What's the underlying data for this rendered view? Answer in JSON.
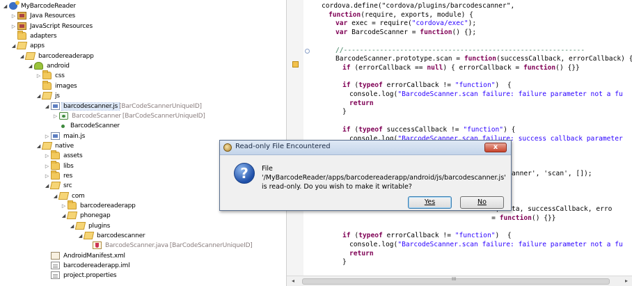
{
  "tree": {
    "items": [
      {
        "label": "MyBarcodeReader",
        "depth": 0,
        "expander": "open",
        "icon": "project-icon"
      },
      {
        "label": "Java Resources",
        "depth": 1,
        "expander": "closed",
        "icon": "library-icon"
      },
      {
        "label": "JavaScript Resources",
        "depth": 1,
        "expander": "closed",
        "icon": "library-icon"
      },
      {
        "label": "adapters",
        "depth": 1,
        "expander": "none",
        "icon": "folder-icon"
      },
      {
        "label": "apps",
        "depth": 1,
        "expander": "open",
        "icon": "open-folder-icon"
      },
      {
        "label": "barcodereaderapp",
        "depth": 2,
        "expander": "open",
        "icon": "open-folder-icon"
      },
      {
        "label": "android",
        "depth": 3,
        "expander": "open",
        "icon": "android-icon"
      },
      {
        "label": "css",
        "depth": 4,
        "expander": "closed",
        "icon": "folder-icon"
      },
      {
        "label": "images",
        "depth": 4,
        "expander": "none",
        "icon": "folder-icon"
      },
      {
        "label": "js",
        "depth": 4,
        "expander": "open",
        "icon": "open-folder-icon"
      },
      {
        "label": "barcodescanner.js",
        "suffix": "[BarCodeScannerUniqueID]",
        "depth": 5,
        "expander": "open",
        "icon": "js-file-icon",
        "selected": true
      },
      {
        "label": "BarcodeScanner",
        "suffix": "[BarCodeScannerUniqueID]",
        "depth": 6,
        "expander": "closed",
        "icon": "js-class-icon",
        "dim": true
      },
      {
        "label": "BarcodeScanner",
        "depth": 6,
        "expander": "none",
        "icon": "dot",
        "dot": true
      },
      {
        "label": "main.js",
        "depth": 5,
        "expander": "closed",
        "icon": "js-file-icon"
      },
      {
        "label": "native",
        "depth": 4,
        "expander": "open",
        "icon": "open-folder-icon"
      },
      {
        "label": "assets",
        "depth": 5,
        "expander": "closed",
        "icon": "folder-icon"
      },
      {
        "label": "libs",
        "depth": 5,
        "expander": "closed",
        "icon": "folder-icon"
      },
      {
        "label": "res",
        "depth": 5,
        "expander": "closed",
        "icon": "folder-icon"
      },
      {
        "label": "src",
        "depth": 5,
        "expander": "open",
        "icon": "open-folder-icon"
      },
      {
        "label": "com",
        "depth": 6,
        "expander": "open",
        "icon": "open-folder-icon"
      },
      {
        "label": "barcodereaderapp",
        "depth": 7,
        "expander": "closed",
        "icon": "folder-icon"
      },
      {
        "label": "phonegap",
        "depth": 7,
        "expander": "open",
        "icon": "open-folder-icon"
      },
      {
        "label": "plugins",
        "depth": 8,
        "expander": "open",
        "icon": "open-folder-icon"
      },
      {
        "label": "barcodescanner",
        "depth": 9,
        "expander": "open",
        "icon": "open-folder-icon"
      },
      {
        "label": "BarcodeScanner.java",
        "suffix": "[BarCodeScannerUniqueID]",
        "depth": 10,
        "expander": "none",
        "icon": "java-file-icon",
        "dim": true
      },
      {
        "label": "AndroidManifest.xml",
        "depth": 5,
        "expander": "none",
        "icon": "xml-file-icon"
      },
      {
        "label": "barcodereaderapp.iml",
        "depth": 5,
        "expander": "none",
        "icon": "document-icon"
      },
      {
        "label": "project.properties",
        "depth": 5,
        "expander": "none",
        "icon": "document-icon"
      }
    ]
  },
  "editor": {
    "lines": [
      {
        "indent": 1,
        "parts": [
          [
            "t",
            "cordova.define(\"cordova/plugins/barcodescanner\","
          ]
        ]
      },
      {
        "indent": 2,
        "parts": [
          [
            "k",
            "function"
          ],
          [
            "t",
            "(require, exports, module) {"
          ]
        ]
      },
      {
        "indent": 3,
        "parts": [
          [
            "k",
            "var"
          ],
          [
            "t",
            " exec = require("
          ],
          [
            "s",
            "\"cordova/exec\""
          ],
          [
            "t",
            ");"
          ]
        ]
      },
      {
        "indent": 3,
        "parts": [
          [
            "k",
            "var"
          ],
          [
            "t",
            " BarcodeScanner = "
          ],
          [
            "k",
            "function"
          ],
          [
            "t",
            "() {};"
          ]
        ]
      },
      {
        "indent": 0,
        "parts": []
      },
      {
        "indent": 3,
        "parts": [
          [
            "c",
            "//------------------------------------------------------------"
          ]
        ]
      },
      {
        "indent": 3,
        "parts": [
          [
            "t",
            "BarcodeScanner.prototype.scan = "
          ],
          [
            "k",
            "function"
          ],
          [
            "t",
            "(successCallback, errorCallback) {"
          ]
        ]
      },
      {
        "indent": 4,
        "parts": [
          [
            "k",
            "if"
          ],
          [
            "t",
            " (errorCallback == "
          ],
          [
            "k",
            "null"
          ],
          [
            "t",
            ") { errorCallback = "
          ],
          [
            "k",
            "function"
          ],
          [
            "t",
            "() {}}"
          ]
        ]
      },
      {
        "indent": 0,
        "parts": []
      },
      {
        "indent": 4,
        "parts": [
          [
            "k",
            "if"
          ],
          [
            "t",
            " ("
          ],
          [
            "k",
            "typeof"
          ],
          [
            "t",
            " errorCallback != "
          ],
          [
            "s",
            "\"function\""
          ],
          [
            "t",
            ")  {"
          ]
        ]
      },
      {
        "indent": 5,
        "parts": [
          [
            "t",
            "console.log("
          ],
          [
            "s",
            "\"BarcodeScanner.scan failure: failure parameter not a fu"
          ]
        ]
      },
      {
        "indent": 5,
        "parts": [
          [
            "k",
            "return"
          ]
        ]
      },
      {
        "indent": 4,
        "parts": [
          [
            "t",
            "}"
          ]
        ]
      },
      {
        "indent": 0,
        "parts": []
      },
      {
        "indent": 4,
        "parts": [
          [
            "k",
            "if"
          ],
          [
            "t",
            " ("
          ],
          [
            "k",
            "typeof"
          ],
          [
            "t",
            " successCallback != "
          ],
          [
            "s",
            "\"function\""
          ],
          [
            "t",
            ") {"
          ]
        ]
      },
      {
        "indent": 5,
        "parts": [
          [
            "t",
            "console.log("
          ],
          [
            "s",
            "\"BarcodeScanner.scan failure: success callback parameter"
          ]
        ]
      },
      {
        "indent": 5,
        "parts": [
          [
            "k",
            "return"
          ]
        ]
      },
      {
        "indent": 0,
        "parts": []
      },
      {
        "indent": 0,
        "parts": []
      },
      {
        "indent": 0,
        "parts": [
          [
            "t",
            "                                            odeScanner', 'scan', []);"
          ]
        ]
      },
      {
        "indent": 0,
        "parts": []
      },
      {
        "indent": 0,
        "parts": []
      },
      {
        "indent": 0,
        "parts": []
      },
      {
        "indent": 0,
        "parts": [
          [
            "t",
            "                                            e, data, successCallback, erro"
          ]
        ]
      },
      {
        "indent": 0,
        "parts": [
          [
            "t",
            "                                            = "
          ],
          [
            "k",
            "function"
          ],
          [
            "t",
            "() {}}"
          ]
        ]
      },
      {
        "indent": 0,
        "parts": []
      },
      {
        "indent": 4,
        "parts": [
          [
            "k",
            "if"
          ],
          [
            "t",
            " ("
          ],
          [
            "k",
            "typeof"
          ],
          [
            "t",
            " errorCallback != "
          ],
          [
            "s",
            "\"function\""
          ],
          [
            "t",
            ")  {"
          ]
        ]
      },
      {
        "indent": 5,
        "parts": [
          [
            "t",
            "console.log("
          ],
          [
            "s",
            "\"BarcodeScanner.scan failure: failure parameter not a fu"
          ]
        ]
      },
      {
        "indent": 5,
        "parts": [
          [
            "k",
            "return"
          ]
        ]
      },
      {
        "indent": 4,
        "parts": [
          [
            "t",
            "}"
          ]
        ]
      },
      {
        "indent": 0,
        "parts": []
      },
      {
        "indent": 4,
        "parts": [
          [
            "k",
            "if"
          ],
          [
            "t",
            " ("
          ],
          [
            "k",
            "typeof"
          ],
          [
            "t",
            " successCallback != "
          ],
          [
            "s",
            "\"function\""
          ],
          [
            "t",
            ") {"
          ]
        ]
      }
    ],
    "scrollbar_thumb_label": "III"
  },
  "dialog": {
    "title": "Read-only File Encountered",
    "message": "File '/MyBarcodeReader/apps/barcodereaderapp/android/js/barcodescanner.js' is read-only. Do you wish to make it writable?",
    "yes_label": "Yes",
    "no_label": "No",
    "close_label": "x"
  },
  "colors": {
    "keyword": "#7f0055",
    "string": "#2a00ff",
    "comment": "#3f7f5f",
    "selection": "#dde8f7"
  }
}
